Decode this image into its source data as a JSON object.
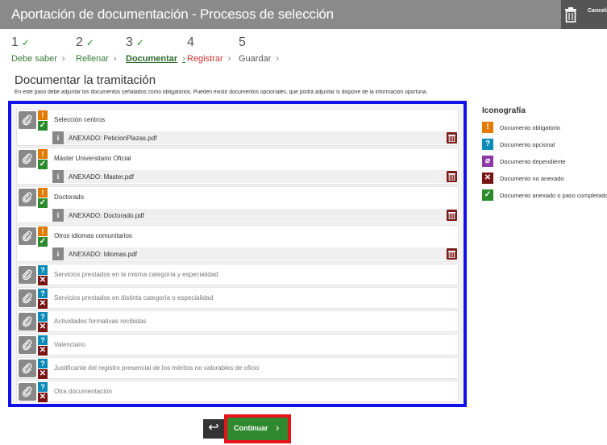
{
  "header": {
    "title": "Aportación de documentación - Procesos de selección",
    "cancel_label": "Cancelar solicitud"
  },
  "steps": [
    {
      "num": "1",
      "done": "✓",
      "label": "Debe saber"
    },
    {
      "num": "2",
      "done": "✓",
      "label": "Rellenar"
    },
    {
      "num": "3",
      "done": "✓",
      "label": "Documentar"
    },
    {
      "num": "4",
      "done": "",
      "label": "Registrar"
    },
    {
      "num": "5",
      "done": "",
      "label": "Guardar"
    }
  ],
  "step_arrow": "›",
  "section": {
    "title": "Documentar la tramitación",
    "description": "En este paso debe adjuntar los documentos señalados como obligatorios. Pueden existir documentos opcionales, que podrá adjuntar si dispone de la información oportuna."
  },
  "documents": [
    {
      "name": "Selección centros",
      "type": "mandatory",
      "status": "attached",
      "attachment": "ANEXADO: PeticionPlazas.pdf"
    },
    {
      "name": "Máster Universitario Oficial",
      "type": "mandatory",
      "status": "attached",
      "attachment": "ANEXADO: Master.pdf"
    },
    {
      "name": "Doctorado",
      "type": "mandatory",
      "status": "attached",
      "attachment": "ANEXADO: Doctorado.pdf"
    },
    {
      "name": "Otros idiomas comunitarios",
      "type": "mandatory",
      "status": "attached",
      "attachment": "ANEXADO: Idiomas.pdf"
    },
    {
      "name": "Servicios prestados en la misma categoría y especialidad",
      "type": "optional",
      "status": "not_attached"
    },
    {
      "name": "Servicios prestados en distinta categoría o especialidad",
      "type": "optional",
      "status": "not_attached"
    },
    {
      "name": "Actividades formativas recibidas",
      "type": "optional",
      "status": "not_attached"
    },
    {
      "name": "Valenciano",
      "type": "optional",
      "status": "not_attached"
    },
    {
      "name": "Justificante del registro presencial de los méritos no valorables de oficio",
      "type": "optional",
      "status": "not_attached"
    },
    {
      "name": "Otra documentación",
      "type": "optional",
      "status": "not_attached"
    }
  ],
  "glyphs": {
    "mandatory": "!",
    "optional": "?",
    "attached": "✓",
    "not_attached": "✕",
    "info": "i"
  },
  "legend": {
    "title": "Iconografía",
    "items": [
      {
        "glyph": "!",
        "icon": "mandatory-icon",
        "color": "#e07a00",
        "label": "Documento obligatorio"
      },
      {
        "glyph": "?",
        "icon": "optional-icon",
        "color": "#0a8ab6",
        "label": "Documento opcional"
      },
      {
        "glyph": "⌀",
        "icon": "dependent-icon",
        "color": "#8a3aa6",
        "label": "Documento dependiente"
      },
      {
        "glyph": "✕",
        "icon": "not-attached-icon",
        "color": "#7a1414",
        "label": "Documento no anexado"
      },
      {
        "glyph": "✓",
        "icon": "attached-icon",
        "color": "#2c8a2c",
        "label": "Documento anexado o paso completado"
      }
    ]
  },
  "footer": {
    "back_glyph": "↩",
    "continue_label": "Continuar",
    "continue_arrow": "›"
  },
  "colors": {
    "header_bg": "#8a8a8a",
    "highlight_blue": "#1010e8",
    "highlight_red": "#e8121c",
    "continue_green": "#2f8a2f"
  }
}
